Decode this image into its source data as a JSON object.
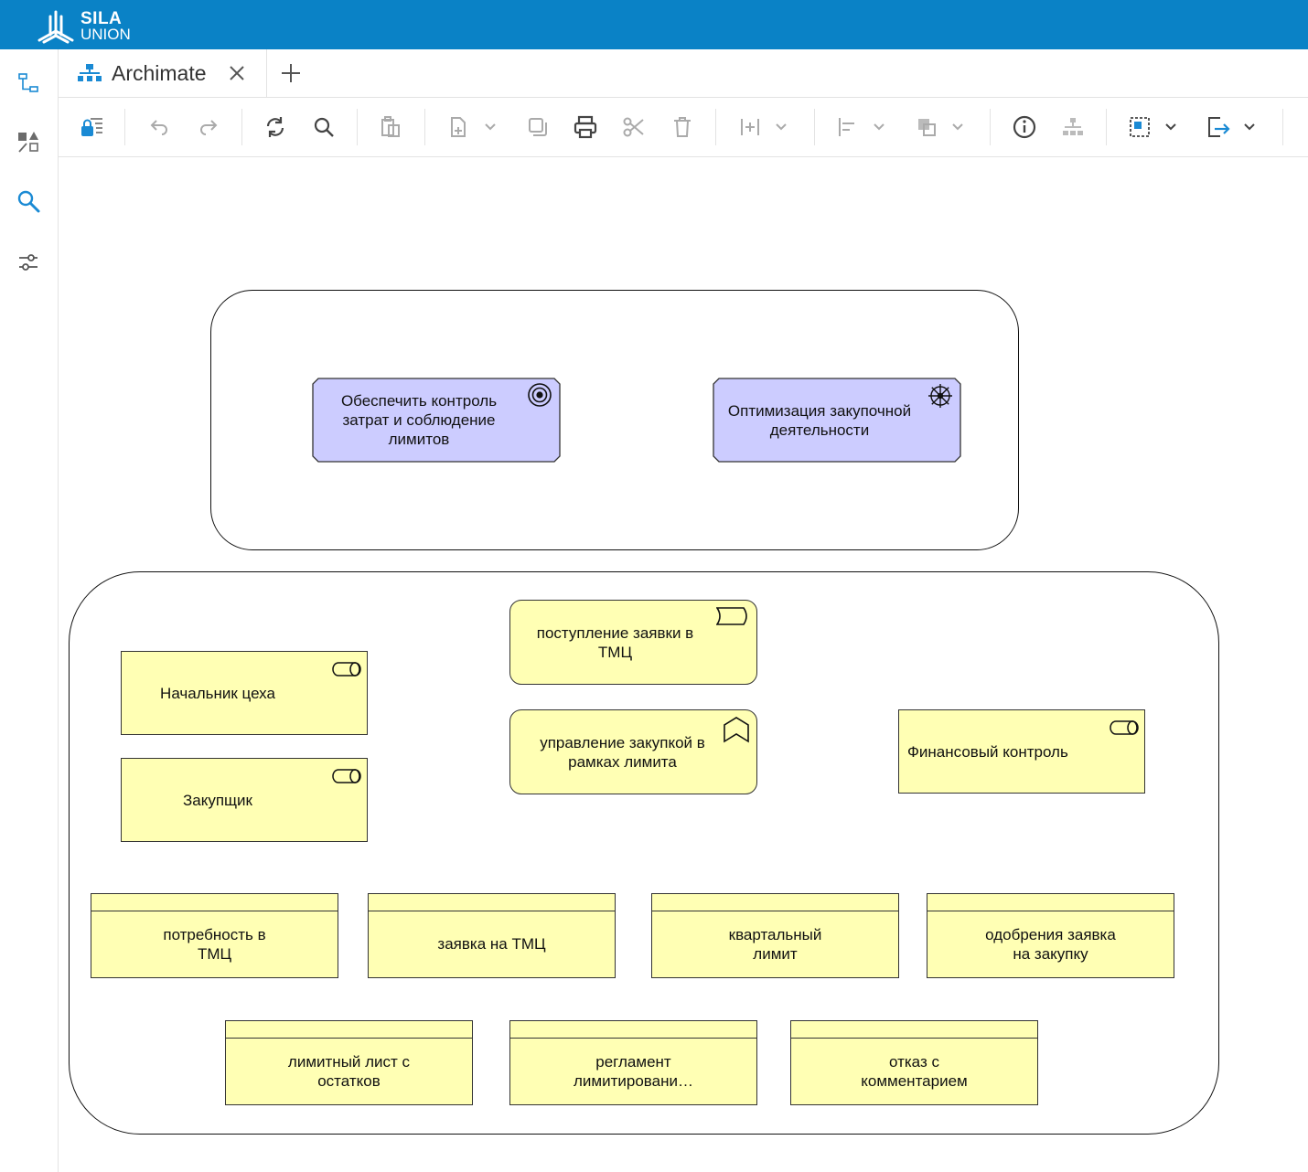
{
  "app": {
    "brand_line1": "SILA",
    "brand_line2": "UNION"
  },
  "tabs": [
    {
      "label": "Archimate"
    }
  ],
  "sidebar": {
    "items": [
      {
        "icon": "tree-icon"
      },
      {
        "icon": "shapes-icon"
      },
      {
        "icon": "search-icon"
      },
      {
        "icon": "sliders-icon"
      }
    ]
  },
  "toolbar": {
    "icons": [
      "lock-layers-icon",
      "undo-icon",
      "redo-icon",
      "refresh-icon",
      "search-icon",
      "paste-icon",
      "new-page-icon",
      "duplicate-icon",
      "print-icon",
      "cut-icon",
      "delete-icon",
      "insert-icon",
      "align-icon",
      "arrange-icon",
      "info-icon",
      "hierarchy-icon",
      "select-icon",
      "export-icon"
    ]
  },
  "diagram": {
    "motivation": {
      "goal": "Обеспечить контроль\nзатрат и соблюдение\nлимитов",
      "driver": "Оптимизация закупочной\nдеятельности"
    },
    "business": {
      "event": "поступление заявки в\nТМЦ",
      "process": "управление закупкой в\nрамках лимита",
      "role_head": "Начальник цеха",
      "role_buyer": "Закупщик",
      "role_finance": "Финансовый контроль",
      "objects_row1": [
        "потребность в\nТМЦ",
        "заявка на ТМЦ",
        "квартальный\nлимит",
        "одобрения заявка\nна закупку"
      ],
      "objects_row2": [
        "лимитный лист с\nостатков",
        "регламент\nлимитировани…",
        "отказ с\nкомментарием"
      ]
    }
  },
  "colors": {
    "brand_bar": "#0a82c6",
    "business_fill": "#ffffb4",
    "motivation_fill": "#ccccff",
    "connector": "#6c8ebf",
    "accent": "#1a8ad4"
  }
}
